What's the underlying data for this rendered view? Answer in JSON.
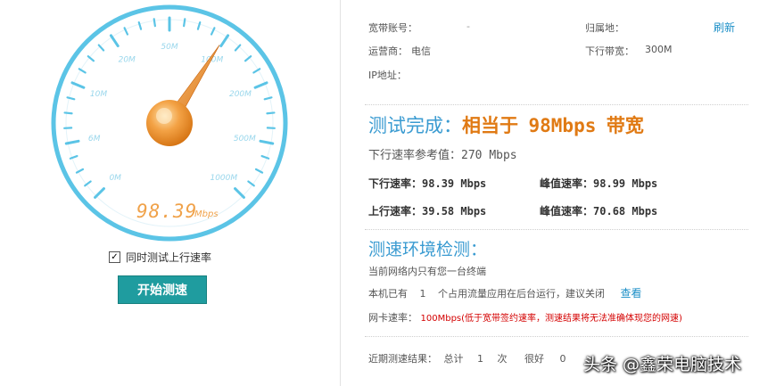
{
  "gauge": {
    "scale_labels": [
      "0M",
      "6M",
      "10M",
      "20M",
      "50M",
      "100M",
      "200M",
      "500M",
      "1000M"
    ],
    "speed_value": "98.39",
    "speed_unit": "Mbps",
    "needle_value_mbps": 98.39
  },
  "controls": {
    "checkbox_label": "同时测试上行速率",
    "checkbox_checked": true,
    "checkbox_mark": "✓",
    "start_button": "开始测速"
  },
  "info": {
    "account_label": "宽带账号：",
    "account_value": "-",
    "region_label": "归属地：",
    "refresh_link": "刷新",
    "operator_label": "运营商：",
    "operator_value": "电信",
    "down_bw_label": "下行带宽：",
    "down_bw_value": "300M",
    "ip_label": "IP地址："
  },
  "result": {
    "title_prefix": "测试完成：",
    "title_equiv": "相当于",
    "title_value": "98Mbps",
    "title_suffix": "带宽",
    "ref_label": "下行速率参考值：",
    "ref_value": "270 Mbps",
    "down_rate_label": "下行速率：",
    "down_rate_value": "98.39 Mbps",
    "peak_down_label": "峰值速率：",
    "peak_down_value": "98.99 Mbps",
    "up_rate_label": "上行速率：",
    "up_rate_value": "39.58 Mbps",
    "peak_up_label": "峰值速率：",
    "peak_up_value": "70.68 Mbps"
  },
  "env": {
    "title": "测速环境检测：",
    "line1": "当前网络内只有您一台终端",
    "line2_prefix": "本机已有",
    "line2_count": "1",
    "line2_suffix": "个占用流量应用在后台运行，建议关闭",
    "view_link": "查看",
    "nic_label": "网卡速率：",
    "nic_value": "100Mbps(低于宽带签约速率，测速结果将无法准确体现您的网速)"
  },
  "recent": {
    "label": "近期测速结果：",
    "total_label": "总计",
    "total_value": "1",
    "times_unit": "次",
    "good_label": "很好",
    "good_value": "0"
  },
  "watermark": "头条 @鑫荣电脑技术",
  "colors": {
    "gauge_ring": "#5bc4e6",
    "accent_blue": "#3a9bd1",
    "accent_orange": "#e07a14",
    "button_teal": "#1f9c9f",
    "warn_red": "#d40000"
  }
}
